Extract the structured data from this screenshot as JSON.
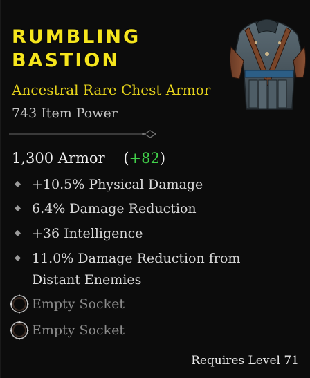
{
  "item": {
    "name_line1": "RUMBLING",
    "name_line2": "BASTION",
    "type": "Ancestral Rare Chest Armor",
    "item_power": "743 Item Power",
    "armor_value": "1,300 Armor",
    "armor_open_paren": "(",
    "armor_bonus": "+82",
    "armor_close_paren": ")",
    "affixes": [
      "+10.5% Physical Damage",
      "6.4% Damage Reduction",
      "+36 Intelligence",
      "11.0% Damage Reduction from",
      "Distant Enemies"
    ],
    "sockets": [
      "Empty Socket",
      "Empty Socket"
    ],
    "requirement": "Requires Level 71"
  },
  "colors": {
    "title": "#f5e51d",
    "rarity": "#e6d31b",
    "bonus": "#41d14a",
    "affix_text": "#d8d8d8",
    "socket_text": "#8c8c8c"
  },
  "icons": {
    "item_image": "chest-armor-icon",
    "affix_bullet": "diamond-bullet-icon",
    "socket": "empty-socket-icon",
    "divider": "ornate-divider-icon"
  }
}
